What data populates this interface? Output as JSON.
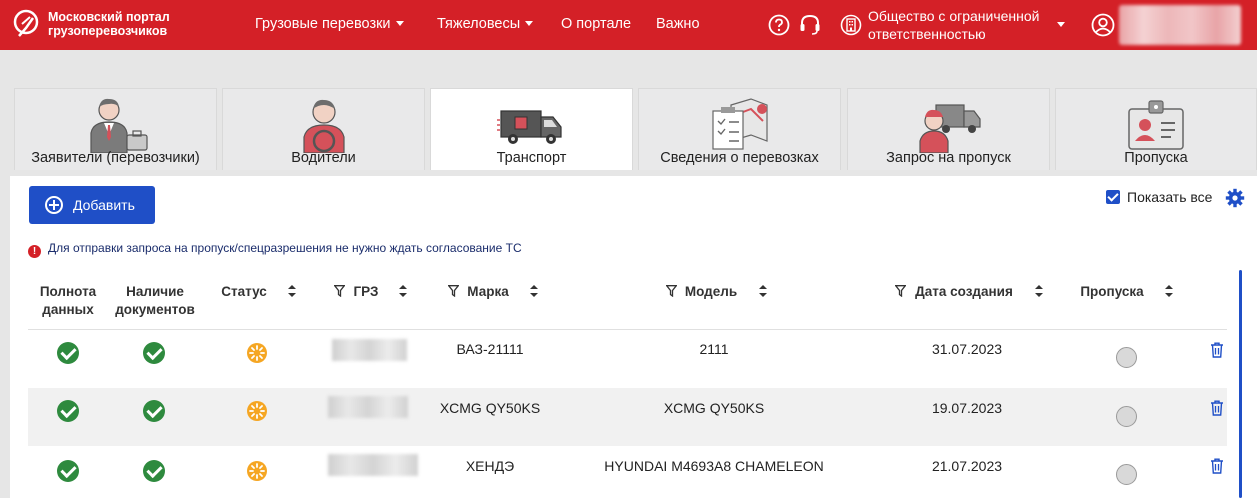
{
  "header": {
    "logo_text": "Московский портал грузоперевозчиков",
    "nav": [
      {
        "label": "Грузовые перевозки",
        "has_dropdown": true
      },
      {
        "label": "Тяжеловесы",
        "has_dropdown": true
      },
      {
        "label": "О портале",
        "has_dropdown": false
      },
      {
        "label": "Важно",
        "has_dropdown": false
      }
    ],
    "help_icon": "question-circle-icon",
    "support_icon": "headset-icon",
    "org_icon": "building-icon",
    "org_name": "Общество с ограниченной ответственностью",
    "user_icon": "user-circle-icon",
    "brand_color": "#d42027"
  },
  "tabs": [
    {
      "label": "Заявители (перевозчики)",
      "icon": "businessman-icon",
      "active": false
    },
    {
      "label": "Водители",
      "icon": "driver-icon",
      "active": false
    },
    {
      "label": "Транспорт",
      "icon": "truck-icon",
      "active": true
    },
    {
      "label": "Сведения о перевозках",
      "icon": "documents-map-icon",
      "active": false
    },
    {
      "label": "Запрос на пропуск",
      "icon": "driver-truck-icon",
      "active": false
    },
    {
      "label": "Пропуска",
      "icon": "id-badge-icon",
      "active": false
    }
  ],
  "toolbar": {
    "add_label": "Добавить",
    "show_all_label": "Показать все",
    "show_all_checked": true,
    "settings_icon": "gear-icon",
    "accent_color": "#1f4fc7"
  },
  "notice": "Для отправки запроса на пропуск/спецразрешения не нужно ждать согласование ТС",
  "table": {
    "columns": [
      {
        "label": "Полнота данных",
        "line1": "Полнота",
        "line2": "данных"
      },
      {
        "label": "Наличие документов",
        "line1": "Наличие",
        "line2": "документов"
      },
      {
        "label": "Статус"
      },
      {
        "label": "ГРЗ"
      },
      {
        "label": "Марка"
      },
      {
        "label": "Модель"
      },
      {
        "label": "Дата создания"
      },
      {
        "label": "Пропуска"
      }
    ],
    "rows": [
      {
        "data_complete": true,
        "docs_present": true,
        "status": "pending",
        "grz": "",
        "brand": "ВАЗ-21111",
        "model": "2111",
        "created": "31.07.2023",
        "pass": "none"
      },
      {
        "data_complete": true,
        "docs_present": true,
        "status": "pending",
        "grz": "",
        "brand": "XCMG QY50KS",
        "model": "XCMG QY50KS",
        "created": "19.07.2023",
        "pass": "none"
      },
      {
        "data_complete": true,
        "docs_present": true,
        "status": "pending",
        "grz": "",
        "brand": "ХЕНДЭ",
        "model": "HYUNDAI M4693A8 CHAMELEON",
        "created": "21.07.2023",
        "pass": "none"
      }
    ]
  }
}
